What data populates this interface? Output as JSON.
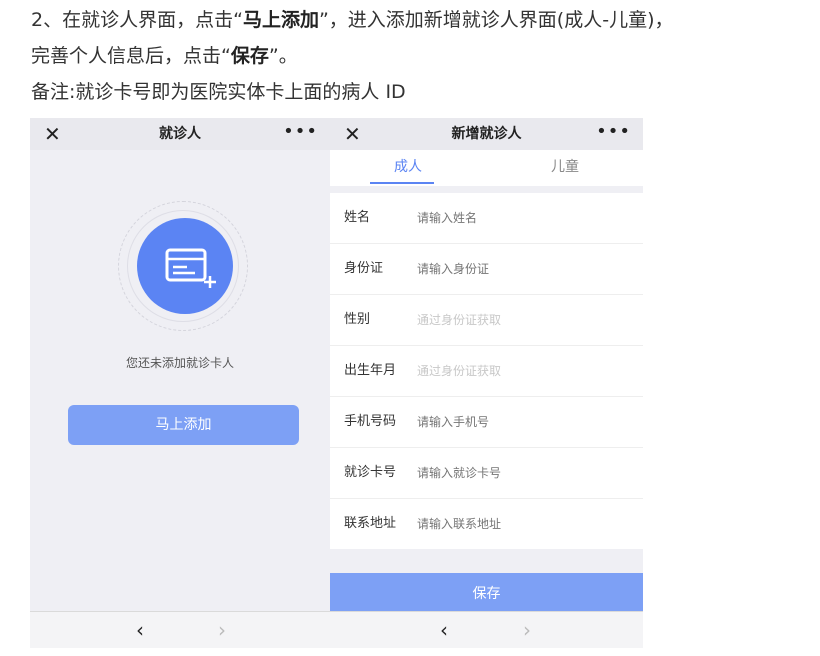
{
  "doc": {
    "line1_a": "2、在就诊人界面，点击“",
    "line1_b": "马上添加",
    "line1_c": "”，进入添加新增就诊人界面(成人-儿童)，",
    "line2_a": "完善个人信息后，点击“",
    "line2_b": "保存",
    "line2_c": "”。",
    "line3": "备注:就诊卡号即为医院实体卡上面的病人 ID"
  },
  "left_phone": {
    "title": "就诊人",
    "close": "✕",
    "more": "•••",
    "empty_text": "您还未添加就诊卡人",
    "add_button": "马上添加",
    "back": "‹",
    "forward": "›"
  },
  "right_phone": {
    "title": "新增就诊人",
    "close": "✕",
    "more": "•••",
    "tabs": [
      "成人",
      "儿童"
    ],
    "fields": [
      {
        "label": "姓名",
        "placeholder": "请输入姓名"
      },
      {
        "label": "身份证",
        "placeholder": "请输入身份证"
      },
      {
        "label": "性别",
        "placeholder": "通过身份证获取"
      },
      {
        "label": "出生年月",
        "placeholder": "通过身份证获取"
      },
      {
        "label": "手机号码",
        "placeholder": "请输入手机号"
      },
      {
        "label": "就诊卡号",
        "placeholder": "请输入就诊卡号"
      },
      {
        "label": "联系地址",
        "placeholder": "请输入联系地址"
      }
    ],
    "save_button": "保存",
    "back": "‹",
    "forward": "›"
  },
  "colors": {
    "accent": "#5b84f3",
    "button": "#7da0f5"
  },
  "icons": {
    "card": "id-card-add-icon"
  }
}
